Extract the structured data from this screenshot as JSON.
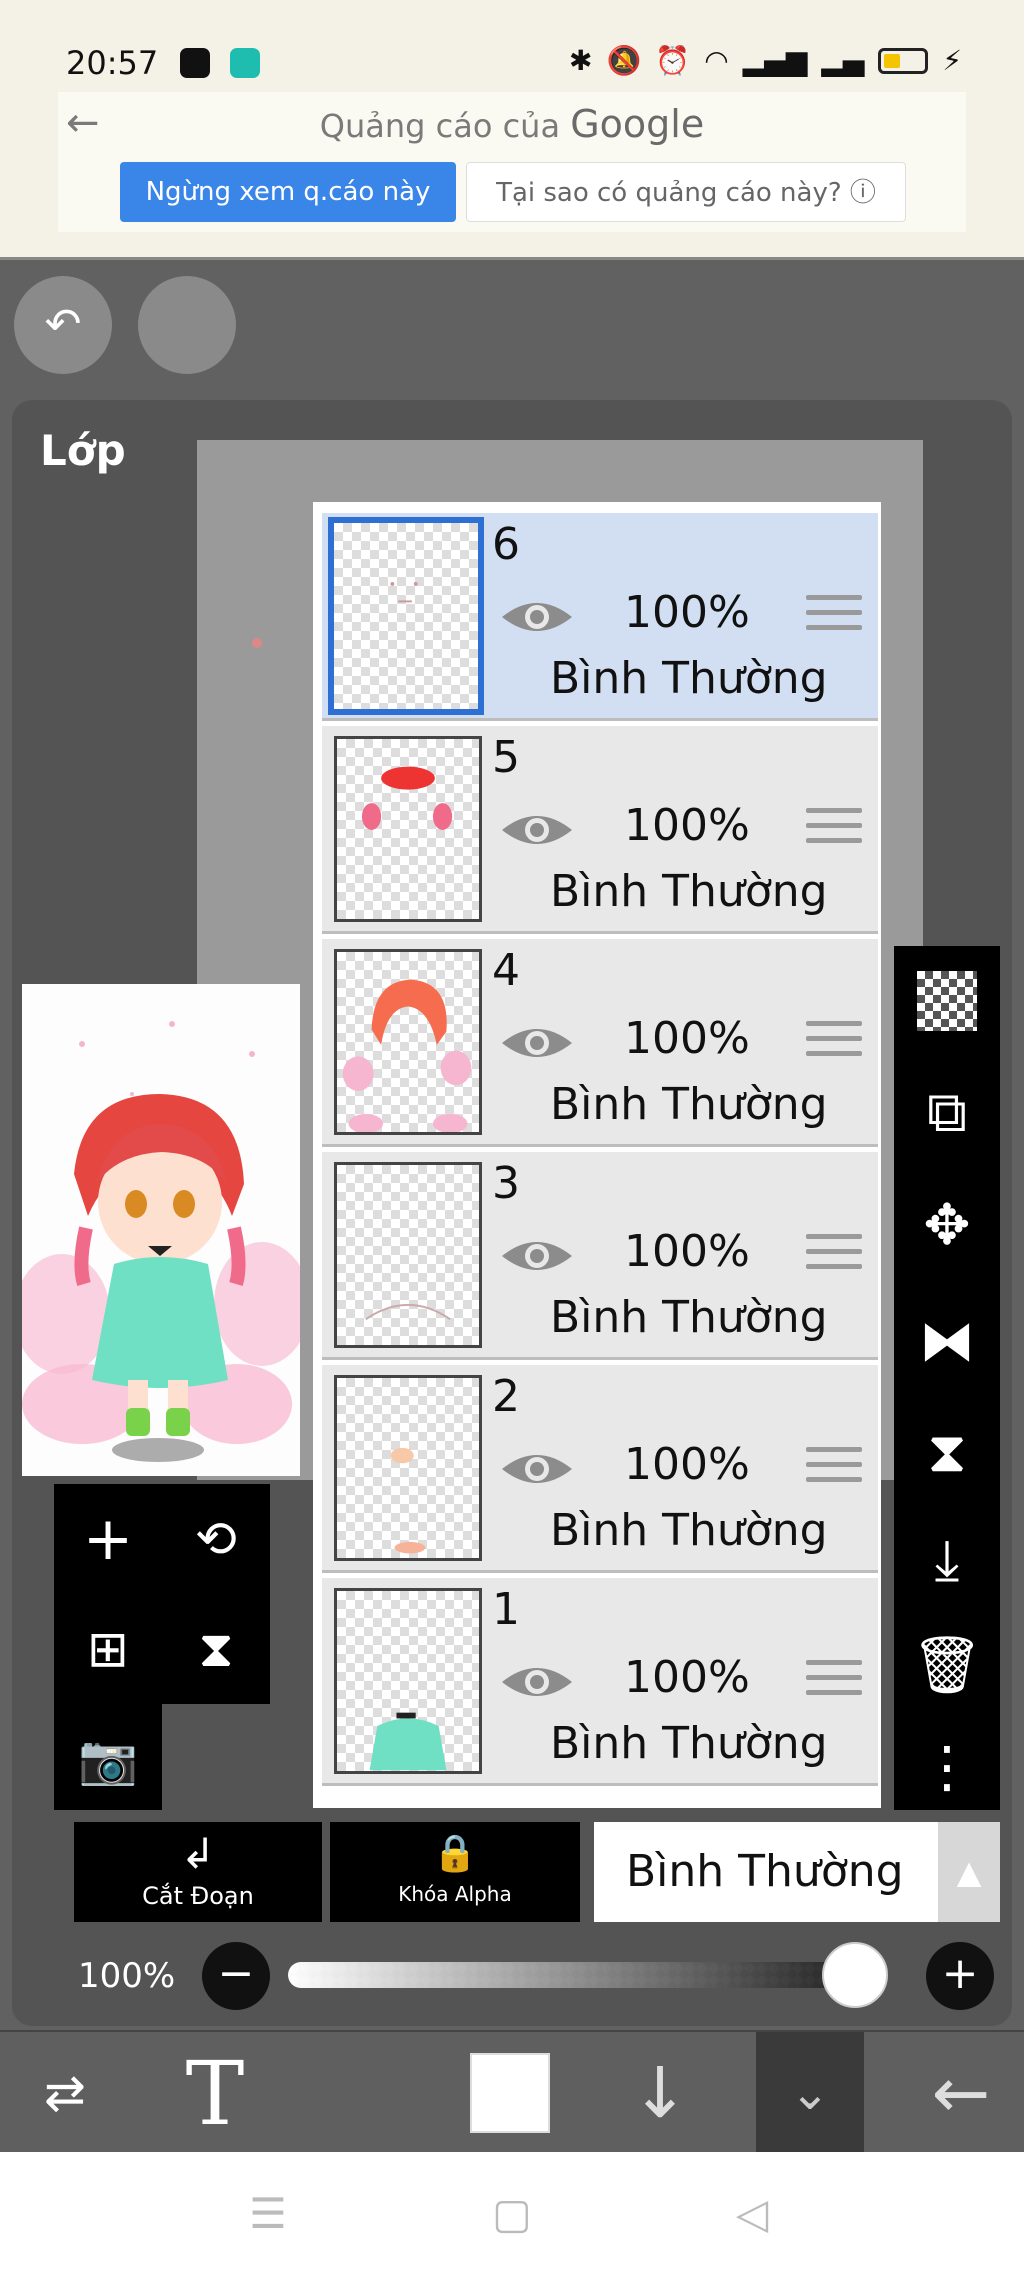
{
  "status_bar": {
    "time": "20:57",
    "battery_level": 0.3
  },
  "ad": {
    "title_prefix": "Quảng cáo của",
    "title_brand": "Google",
    "stop_button": "Ngừng xem q.cáo này",
    "why_button": "Tại sao có quảng cáo này? ⓘ"
  },
  "panel": {
    "title": "Lớp"
  },
  "layers": [
    {
      "number": "6",
      "opacity": "100%",
      "blend": "Bình Thường",
      "selected": true
    },
    {
      "number": "5",
      "opacity": "100%",
      "blend": "Bình Thường",
      "selected": false
    },
    {
      "number": "4",
      "opacity": "100%",
      "blend": "Bình Thường",
      "selected": false
    },
    {
      "number": "3",
      "opacity": "100%",
      "blend": "Bình Thường",
      "selected": false
    },
    {
      "number": "2",
      "opacity": "100%",
      "blend": "Bình Thường",
      "selected": false
    },
    {
      "number": "1",
      "opacity": "100%",
      "blend": "Bình Thường",
      "selected": false
    }
  ],
  "controls": {
    "clip_label": "Cắt Đoạn",
    "alpha_lock_label": "Khóa Alpha",
    "blend_mode_value": "Bình Thường",
    "opacity_label": "100%",
    "opacity_value": 1.0
  },
  "colors": {
    "selected_layer_bg": "#d2dff2",
    "selected_border": "#2d6fd2",
    "ad_button": "#3a86e8"
  }
}
